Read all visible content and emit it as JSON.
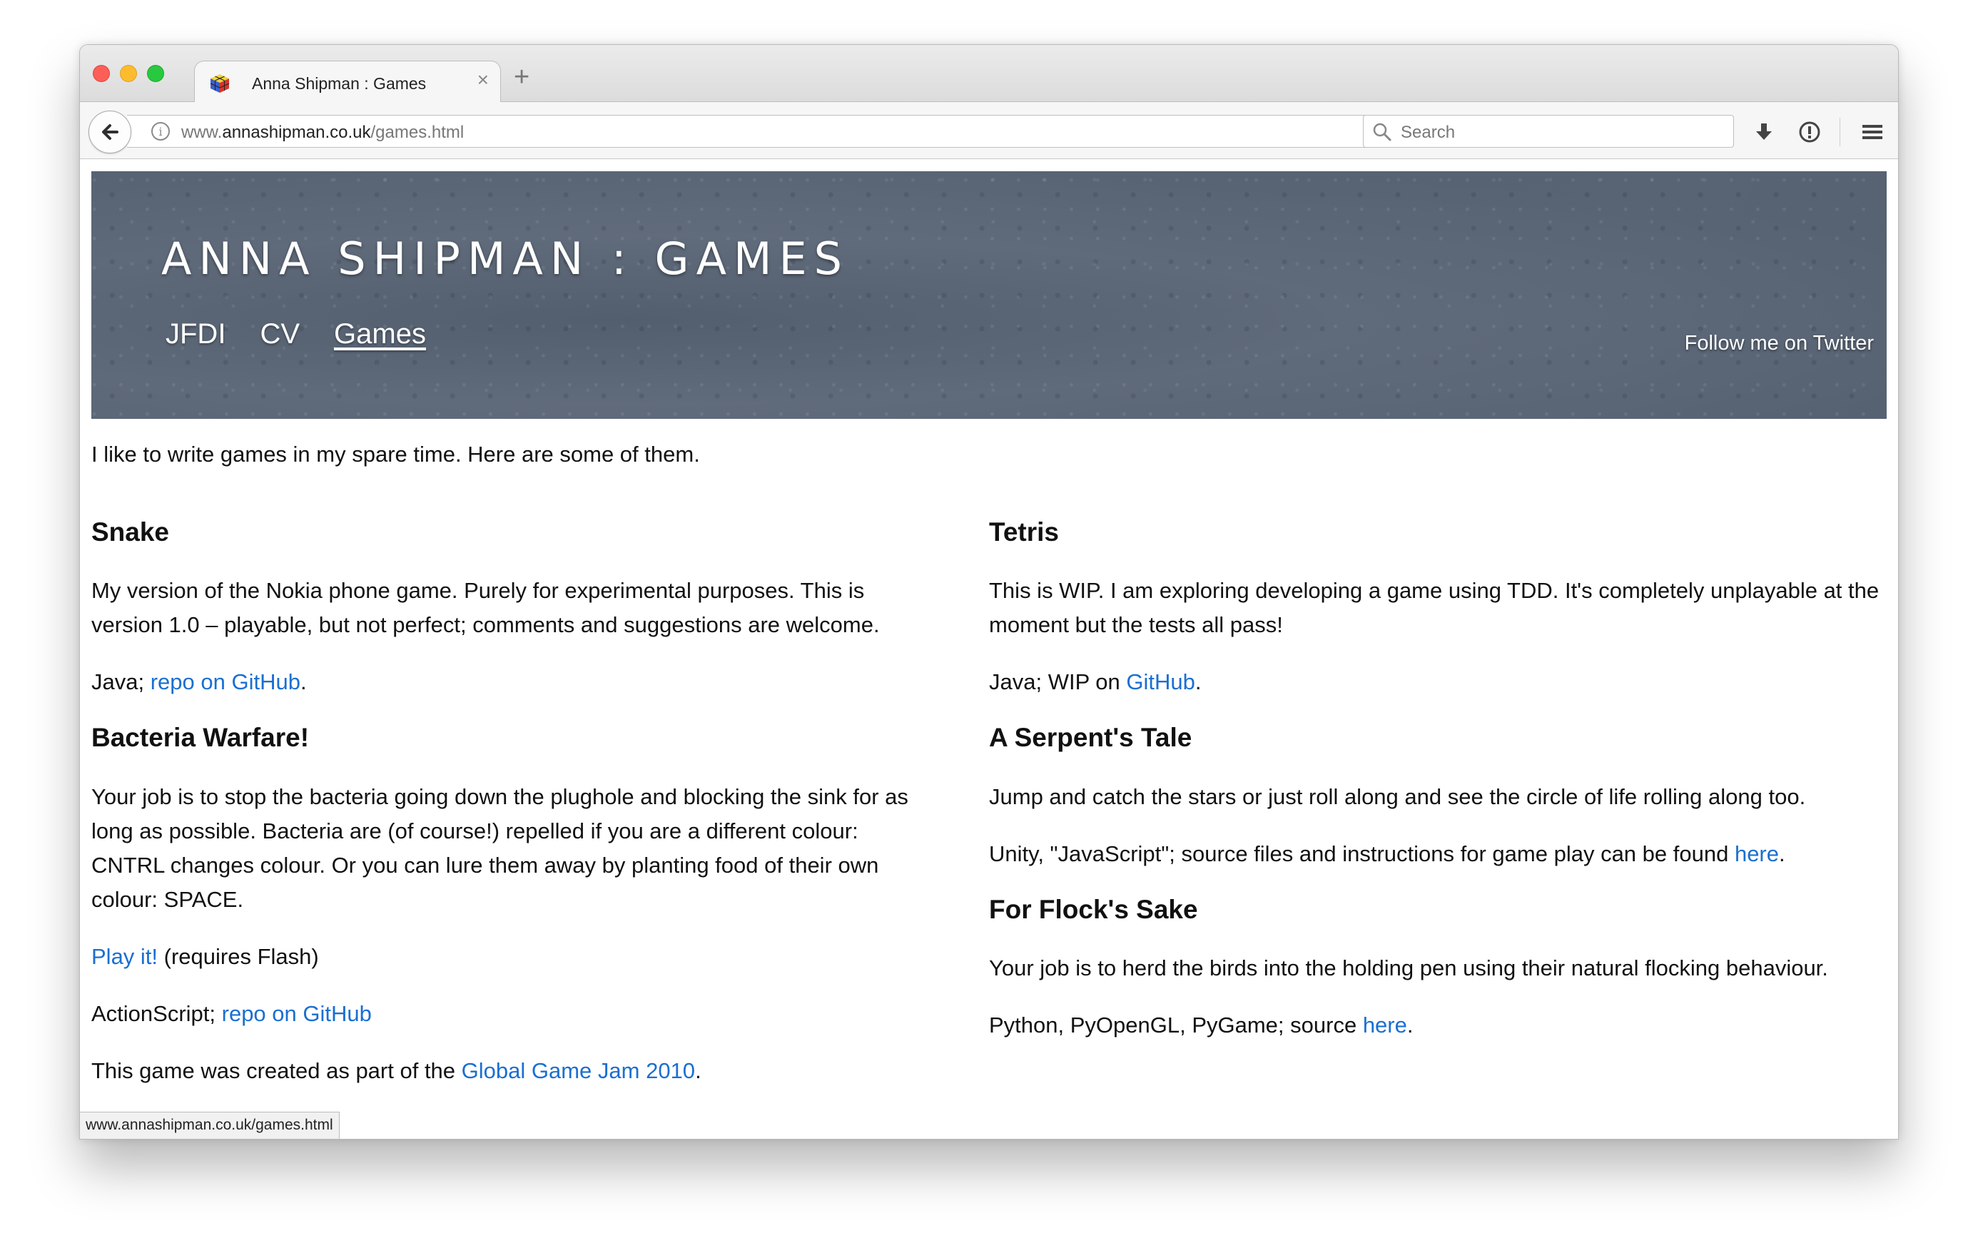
{
  "browser": {
    "tab_title": "Anna Shipman : Games",
    "tab_close": "×",
    "new_tab": "+",
    "url_prefix": "www.",
    "url_domain": "annashipman.co.uk",
    "url_path": "/games.html",
    "search_placeholder": "Search",
    "status_url": "www.annashipman.co.uk/games.html"
  },
  "banner": {
    "title": "ANNA SHIPMAN : GAMES",
    "nav": [
      "JFDI",
      "CV",
      "Games"
    ],
    "follow": "Follow me on Twitter"
  },
  "intro": "I like to write games in my spare time. Here are some of them.",
  "left": {
    "snake": {
      "title": "Snake",
      "desc": "My version of the Nokia phone game. Purely for experimental purposes. This is version 1.0 – playable, but not perfect; comments and suggestions are welcome.",
      "tech": "Java; ",
      "link": "repo on GitHub",
      "tail": "."
    },
    "bacteria": {
      "title": "Bacteria Warfare!",
      "desc": "Your job is to stop the bacteria going down the plughole and blocking the sink for as long as possible. Bacteria are (of course!) repelled if you are a different colour: CNTRL changes colour. Or you can lure them away by planting food of their own colour: SPACE.",
      "play_link": "Play it!",
      "play_tail": " (requires Flash)",
      "tech": "ActionScript; ",
      "link": "repo on GitHub",
      "jam_pre": "This game was created as part of the ",
      "jam_link": "Global Game Jam 2010",
      "jam_tail": "."
    }
  },
  "right": {
    "tetris": {
      "title": "Tetris",
      "desc": "This is WIP. I am exploring developing a game using TDD. It's completely unplayable at the moment but the tests all pass!",
      "tech": "Java; WIP on ",
      "link": "GitHub",
      "tail": "."
    },
    "serpent": {
      "title": "A Serpent's Tale",
      "desc": "Jump and catch the stars or just roll along and see the circle of life rolling along too.",
      "tech": "Unity, \"JavaScript\"; source files and instructions for game play can be found ",
      "link": "here",
      "tail": "."
    },
    "flock": {
      "title": "For Flock's Sake",
      "desc": "Your job is to herd the birds into the holding pen using their natural flocking behaviour.",
      "tech": "Python, PyOpenGL, PyGame; source ",
      "link": "here",
      "tail": "."
    }
  }
}
